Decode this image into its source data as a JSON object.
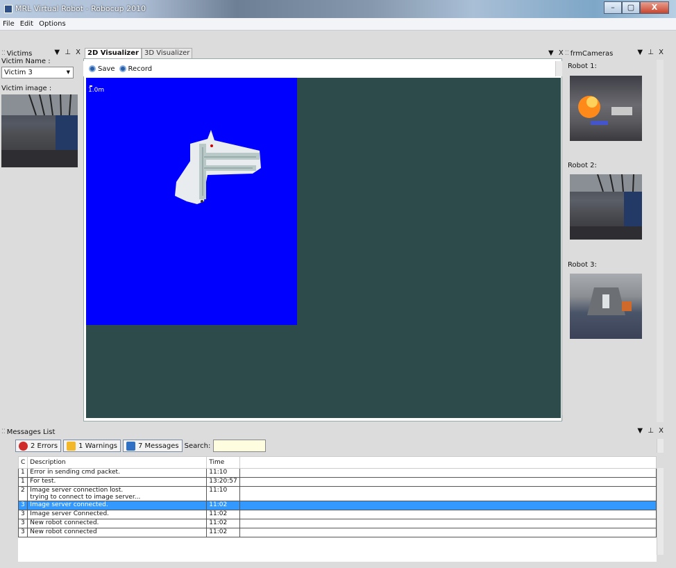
{
  "window": {
    "title": "MRL Virtual Robot - Robocup 2010",
    "min": "–",
    "max": "▢",
    "close": "X"
  },
  "menu": [
    "File",
    "Edit",
    "Options"
  ],
  "victims_panel": {
    "title": "Victims",
    "controls": "▼ ⊥ X",
    "name_label": "Victim Name :",
    "selected_victim": "Victim 3",
    "image_label": "Victim image :"
  },
  "center_panel": {
    "tabs": [
      "2D Visualizer",
      "3D Visualizer"
    ],
    "controls": "▼ X",
    "save_label": "Save",
    "record_label": "Record",
    "scale_label": "1.0m",
    "colors": {
      "map_bg": "#0000fe",
      "canvas_bg": "#2e4b4b"
    }
  },
  "cameras_panel": {
    "title": "frmCameras",
    "controls": "▼ ⊥ X",
    "robots": [
      "Robot 1:",
      "Robot 2:",
      "Robot 3:"
    ]
  },
  "messages_panel": {
    "title": "Messages List",
    "controls": "▼ ⊥ X",
    "errors": "2 Errors",
    "warnings": "1 Warnings",
    "messages": "7 Messages",
    "search_label": "Search:",
    "search_value": "",
    "columns": [
      "C",
      "Description",
      "Time"
    ],
    "rows": [
      {
        "c": "1",
        "desc": "Error in sending cmd packet.",
        "time": "11:10"
      },
      {
        "c": "1",
        "desc": "For test.",
        "time": "13:20:57"
      },
      {
        "c": "2",
        "desc": "Image server connection lost.",
        "desc2": "trying to connect to image server...",
        "time": "11:10"
      },
      {
        "c": "3",
        "desc": "Image server connected.",
        "time": "11:02",
        "selected": true
      },
      {
        "c": "3",
        "desc": "Image server Connected.",
        "time": "11:02"
      },
      {
        "c": "3",
        "desc": "New robot connected.",
        "time": "11:02"
      },
      {
        "c": "3",
        "desc": "New robot connected",
        "time": "11:02"
      }
    ]
  }
}
